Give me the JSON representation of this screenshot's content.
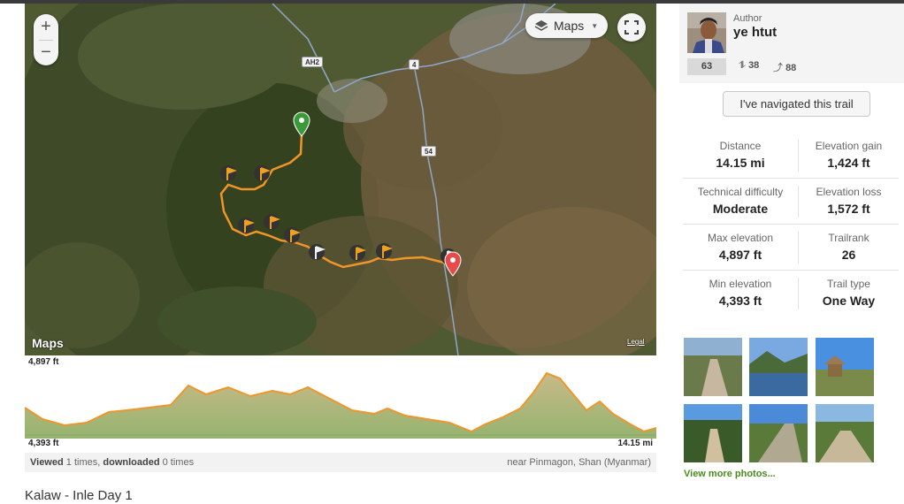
{
  "map": {
    "zoom_in": "+",
    "zoom_out": "−",
    "map_type_label": "Maps",
    "attribution": "Maps",
    "legal_label": "Legal",
    "road_labels": [
      "AH2",
      "4",
      "54",
      "54"
    ]
  },
  "elevation_profile": {
    "max_label": "4,897 ft",
    "min_label": "4,393 ft",
    "distance_label": "14.15 mi",
    "line_color": "#f0952a",
    "fill_color": "#a8b27a"
  },
  "stats_bar": {
    "viewed_label": "Viewed",
    "viewed_count": "1",
    "times_label": "times,",
    "downloaded_label": "downloaded",
    "downloaded_count": "0",
    "times_label2": "times",
    "location": "near Pinmagon, Shan (Myanmar)"
  },
  "trail_title": "Kalaw - Inle Day 1",
  "author": {
    "label": "Author",
    "name": "ye htut",
    "rank": "63",
    "trails": "38",
    "followers": "88"
  },
  "navigate_button": "I've navigated this trail",
  "stats": [
    {
      "label": "Distance",
      "value": "14.15 mi"
    },
    {
      "label": "Elevation gain",
      "value": "1,424 ft"
    },
    {
      "label": "Technical difficulty",
      "value": "Moderate"
    },
    {
      "label": "Elevation loss",
      "value": "1,572 ft"
    },
    {
      "label": "Max elevation",
      "value": "4,897 ft"
    },
    {
      "label": "Trailrank",
      "value": "26"
    },
    {
      "label": "Min elevation",
      "value": "4,393 ft"
    },
    {
      "label": "Trail type",
      "value": "One Way"
    }
  ],
  "more_photos": "View more photos...",
  "colors": {
    "accent_green": "#4a8c1c",
    "trail_orange": "#f0952a",
    "start_marker": "#3a9a3a",
    "end_marker": "#e84a4a"
  }
}
